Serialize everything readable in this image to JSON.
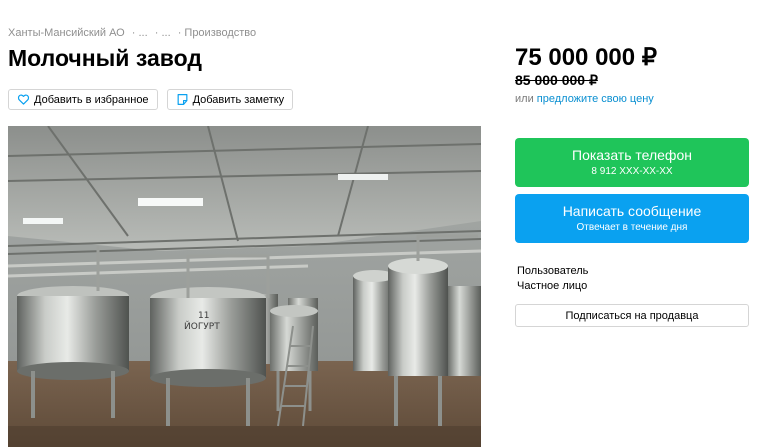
{
  "breadcrumb": {
    "items": [
      "Ханты-Мансийский АО",
      "· ...",
      "· ...",
      "· Производство"
    ]
  },
  "listing": {
    "title": "Молочный завод"
  },
  "actions": {
    "favorite_label": "Добавить в избранное",
    "note_label": "Добавить заметку"
  },
  "photo": {
    "tank_label": "11 ЙОГУРТ"
  },
  "price": {
    "current": "75 000 000 ₽",
    "old": "85 000 000 ₽",
    "offer_prefix": "или",
    "offer_link": "предложите свою цену"
  },
  "contact": {
    "phone_button": "Показать телефон",
    "phone_masked": "8 912 XXX-XX-XX",
    "message_button": "Написать сообщение",
    "message_sub": "Отвечает в течение дня"
  },
  "seller": {
    "type": "Пользователь",
    "kind": "Частное лицо",
    "subscribe_button": "Подписаться на продавца"
  },
  "colors": {
    "phone_green": "#1fc55a",
    "message_blue": "#0aa1f0",
    "link_blue": "#0a8fd1"
  }
}
